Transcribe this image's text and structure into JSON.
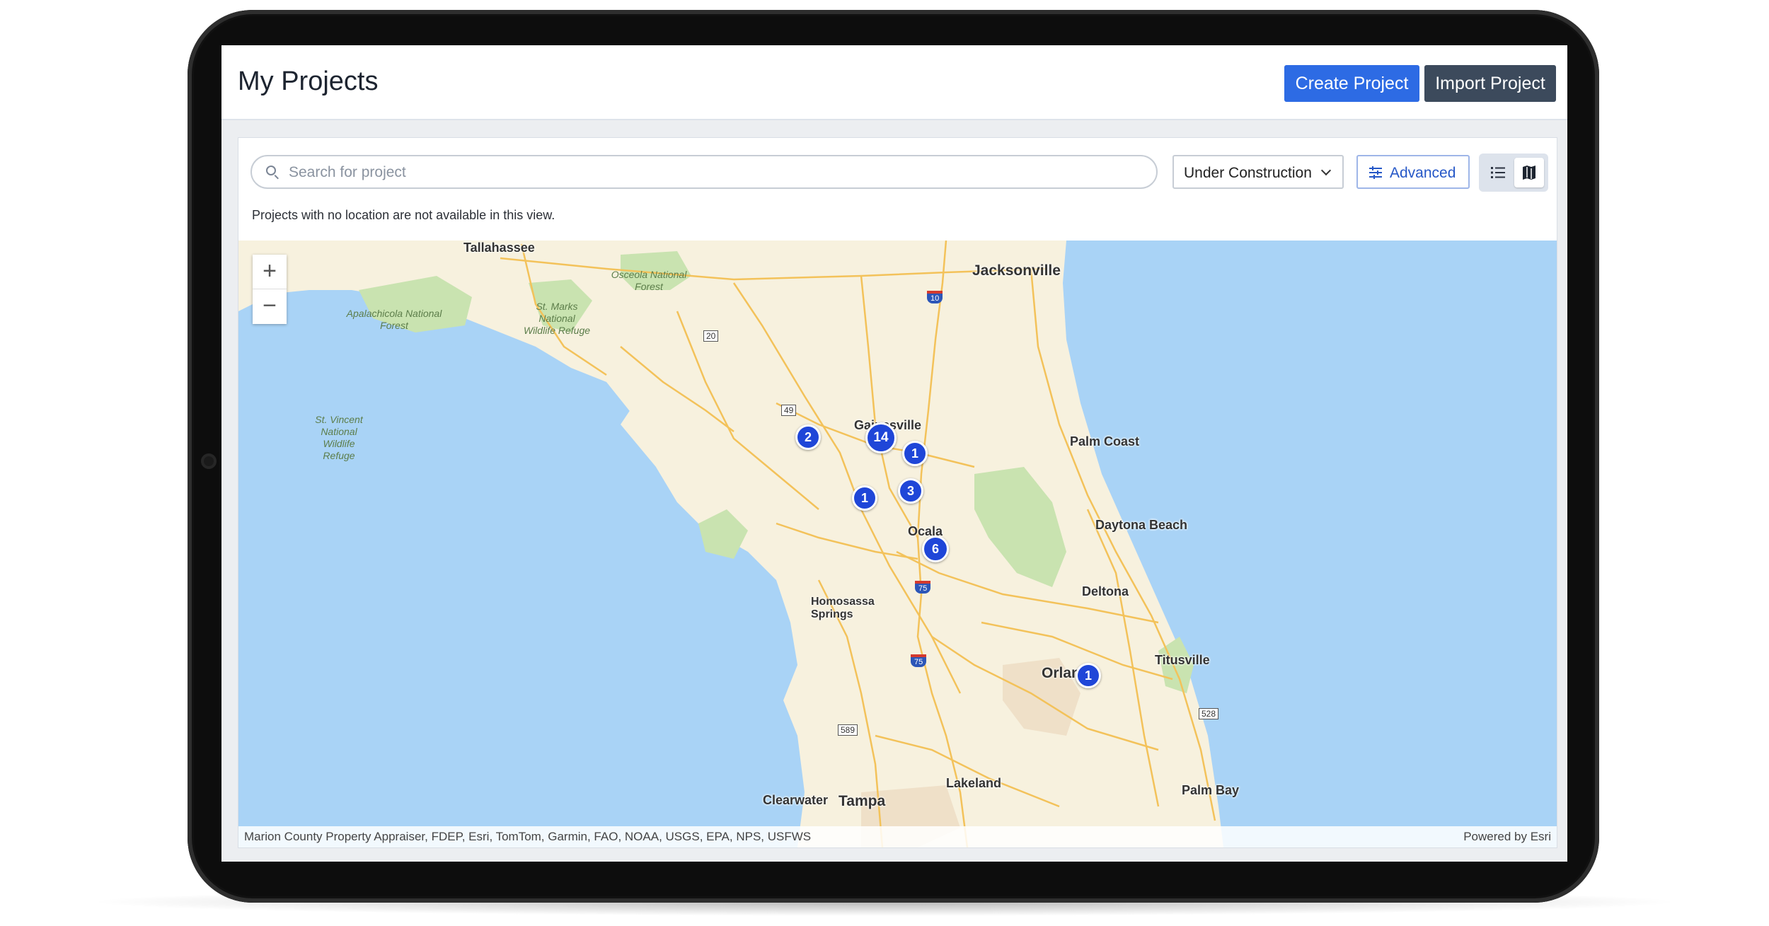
{
  "header": {
    "title": "My Projects",
    "create_label": "Create Project",
    "import_label": "Import Project"
  },
  "toolbar": {
    "search_placeholder": "Search for project",
    "status_filter": "Under Construction",
    "advanced_label": "Advanced",
    "view_toggle_active": "map"
  },
  "notice": "Projects with no location are not available in this view.",
  "map": {
    "attribution": "Marion County Property Appraiser, FDEP, Esri, TomTom, Garmin, FAO, NOAA, USGS, EPA, NPS, USFWS",
    "powered_by": "Powered by Esri",
    "cities": [
      "Tallahassee",
      "Jacksonville",
      "Gainesville",
      "Palm Coast",
      "Ocala",
      "Daytona Beach",
      "Deltona",
      "Homosassa Springs",
      "Titusville",
      "Orlando",
      "Lakeland",
      "Clearwater",
      "Tampa",
      "Palm Bay"
    ],
    "parks": [
      "Osceola National Forest",
      "Apalachicola National Forest",
      "St. Marks National Wildlife Refuge",
      "St. Vincent National Wildlife Refuge"
    ],
    "route_shields": [
      "10",
      "20",
      "49",
      "75",
      "75",
      "589",
      "528"
    ],
    "clusters": [
      {
        "label": "2"
      },
      {
        "label": "14"
      },
      {
        "label": "1"
      },
      {
        "label": "3"
      },
      {
        "label": "1"
      },
      {
        "label": "6"
      },
      {
        "label": "1"
      }
    ],
    "colors": {
      "water": "#a9d3f6",
      "land": "#f7f1de",
      "forest": "#c9e3b0",
      "road": "#f3c25a",
      "cluster": "#1f46d8"
    }
  }
}
